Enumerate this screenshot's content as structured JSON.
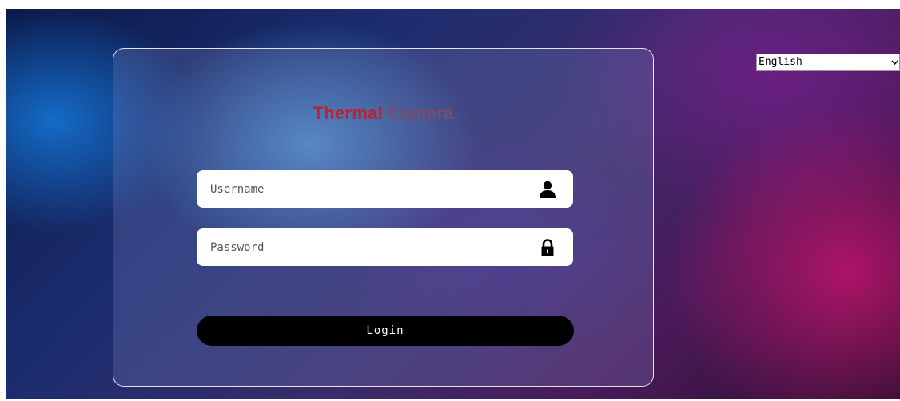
{
  "brand": {
    "word1": "Thermal",
    "word2": "Camera",
    "word1_color": "#c0202a",
    "word2_color": "#7a4e68"
  },
  "login_form": {
    "username": {
      "placeholder": "Username",
      "value": "",
      "icon": "user-icon"
    },
    "password": {
      "placeholder": "Password",
      "value": "",
      "icon": "lock-icon"
    },
    "login_label": "Login"
  },
  "language_select": {
    "selected": "English",
    "icon": "chevron-down-icon"
  }
}
